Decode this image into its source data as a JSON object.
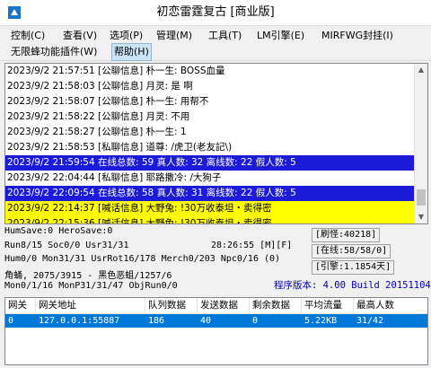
{
  "window": {
    "title": "初恋雷霆复古 [商业版]"
  },
  "menu": {
    "row1": [
      "控制(C)",
      "查看(V)",
      "选项(P)",
      "管理(M)",
      "工具(T)",
      "LM引擎(E)",
      "MIRFWG封挂(I)"
    ],
    "row2": [
      "无限蜂功能插件(W)",
      "帮助(H)"
    ]
  },
  "log": {
    "lines": [
      {
        "text": "2023/9/2 21:57:51 [公聊信息] 朴一生: BOSS血量",
        "style": "normal"
      },
      {
        "text": "2023/9/2 21:58:03 [公聊信息] 月灵: 是 啊",
        "style": "normal"
      },
      {
        "text": "2023/9/2 21:58:07 [公聊信息] 朴一生: 用帮不",
        "style": "normal"
      },
      {
        "text": "2023/9/2 21:58:22 [公聊信息] 月灵: 不用",
        "style": "normal"
      },
      {
        "text": "2023/9/2 21:58:27 [公聊信息] 朴一生: 1",
        "style": "normal"
      },
      {
        "text": "2023/9/2 21:58:53 [私聊信息] 道尊: /虎卫(老友記\\)",
        "style": "normal"
      },
      {
        "text": "2023/9/2 21:59:54 在线总数: 59 真人数: 32 离线数: 22 假人数: 5",
        "style": "blue"
      },
      {
        "text": "2023/9/2 22:04:44 [私聊信息] 耶路撒冷: /大狗子",
        "style": "normal"
      },
      {
        "text": "2023/9/2 22:09:54 在线总数: 58 真人数: 31 离线数: 22 假人数: 5",
        "style": "blue"
      },
      {
        "text": "2023/9/2 22:14:37 [喊话信息] 大野兔: !30万收泰坦・卖得密",
        "style": "yellow"
      },
      {
        "text": "2023/9/2 22:15:36 [喊话信息] 大野兔: !30万收泰坦・卖得密",
        "style": "yellow"
      }
    ]
  },
  "status": {
    "line1": "HumSave:0 HeroSave:0",
    "line2": "Run8/15 Soc0/0 Usr31/31",
    "line2_time": "28:26:55 [M][F]",
    "line3": "Hum0/0 Mon31/31 UsrRot16/178 Merch0/203 Npc0/16 (0)",
    "line4": "角蛹, 2075/3915 - 黑色恶蛆/1257/6",
    "line5": "Mon0/1/16 MonP31/31/47 ObjRun0/0",
    "refresh": "[刷怪:40218]",
    "online": "[在线:58/58/0]",
    "engine": "[引擎:1.1854天]",
    "version": "程序版本: 4.00 Build 20151104"
  },
  "table": {
    "headers": [
      "网关",
      "网关地址",
      "队列数据",
      "发送数据",
      "剩余数据",
      "平均流量",
      "最高人数"
    ],
    "rows": [
      [
        "0",
        "127.0.0.1:55887",
        "186",
        "40",
        "0",
        "5.22KB",
        "31/42"
      ]
    ]
  },
  "colors": {
    "blue_line": "#1c1cd8",
    "yellow_line": "#ffff00",
    "selected_row": "#0078d7",
    "version_text": "#0000c0"
  }
}
